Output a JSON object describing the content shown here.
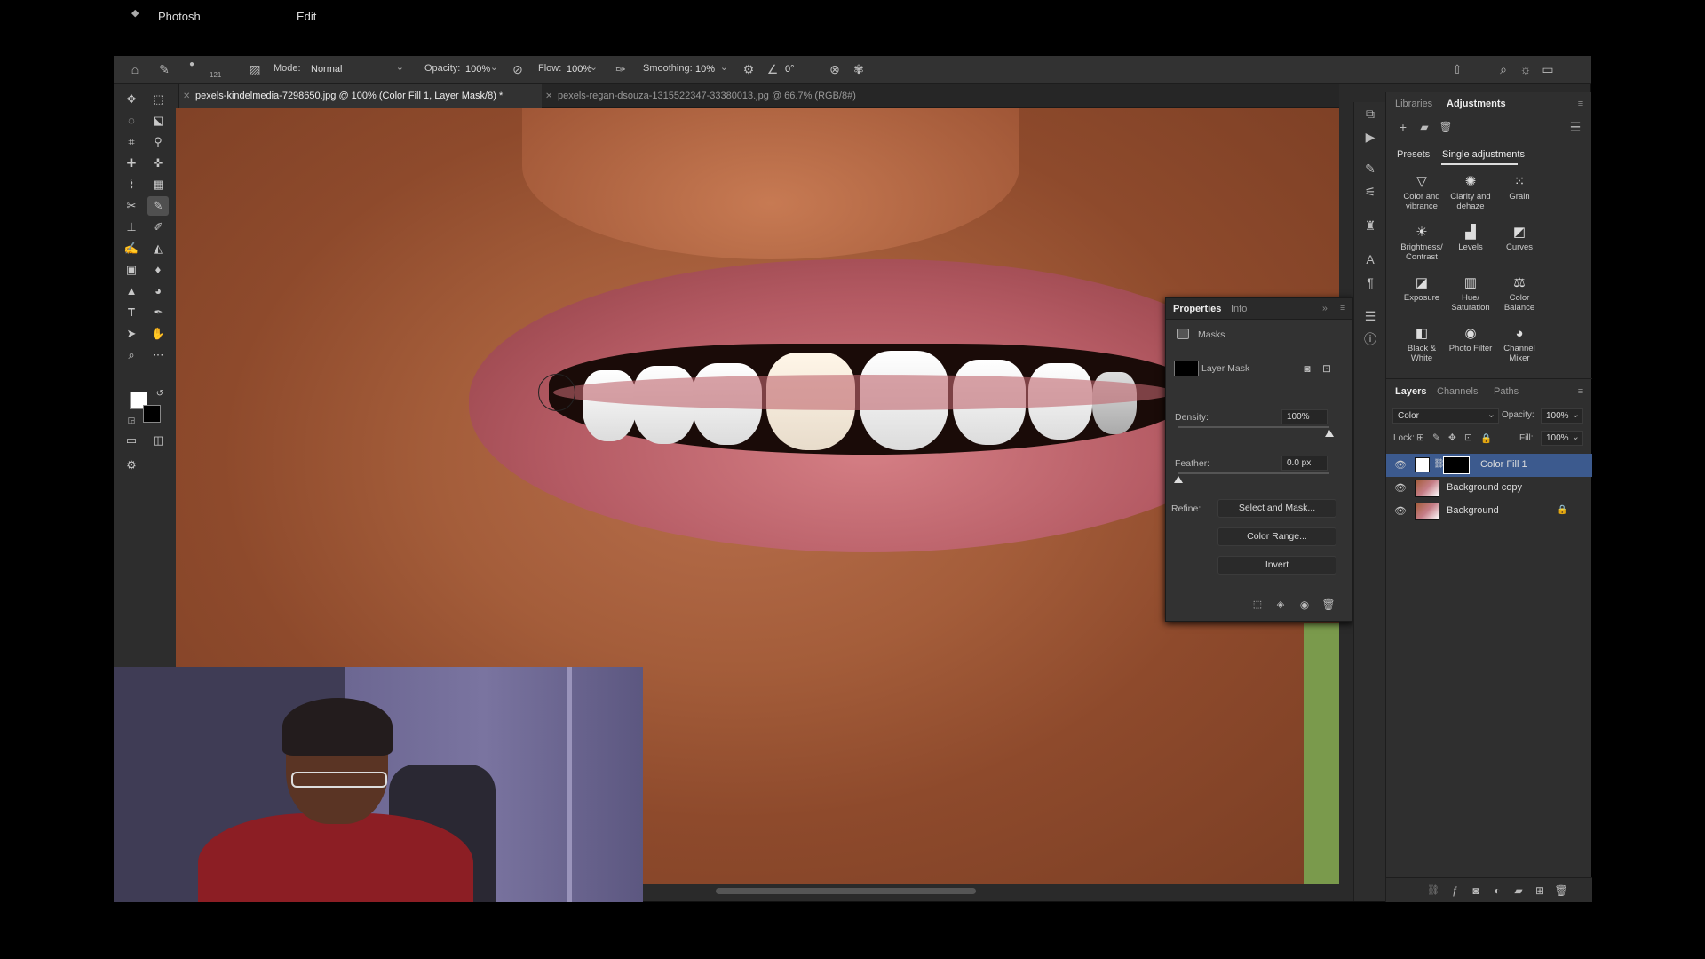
{
  "menubar": {
    "app_name": "Photosh",
    "edit_menu": "Edit"
  },
  "options": {
    "brush_size": "121",
    "mode_label": "Mode:",
    "mode_value": "Normal",
    "opacity_label": "Opacity:",
    "opacity_value": "100%",
    "flow_label": "Flow:",
    "flow_value": "100%",
    "smoothing_label": "Smoothing:",
    "smoothing_value": "10%",
    "angle_value": "0°"
  },
  "tabs": [
    {
      "label": "pexels-kindelmedia-7298650.jpg @ 100% (Color Fill 1, Layer Mask/8) *"
    },
    {
      "label": "pexels-regan-dsouza-1315522347-33380013.jpg @ 66.7% (RGB/8#)"
    }
  ],
  "properties": {
    "tabs": [
      "Properties",
      "Info"
    ],
    "section": "Masks",
    "mask_label": "Layer Mask",
    "density_label": "Density:",
    "density_value": "100%",
    "density_level": 1.0,
    "feather_label": "Feather:",
    "feather_value": "0.0 px",
    "feather_level": 0.0,
    "refine_label": "Refine:",
    "buttons": [
      "Select and Mask...",
      "Color Range...",
      "Invert"
    ]
  },
  "right_panel": {
    "top_tabs": [
      "Libraries",
      "Adjustments"
    ],
    "sub_tabs": [
      "Presets",
      "Single adjustments"
    ],
    "adjustments": [
      {
        "label": "Color and vibrance",
        "icon": "triangle-icon",
        "glyph": "▽"
      },
      {
        "label": "Clarity and dehaze",
        "icon": "sun-dots-icon",
        "glyph": "✺"
      },
      {
        "label": "Grain",
        "icon": "grain-icon",
        "glyph": "⁙"
      },
      {
        "label": "Brightness/ Contrast",
        "icon": "brightness-icon",
        "glyph": "☀"
      },
      {
        "label": "Levels",
        "icon": "levels-icon",
        "glyph": "▟"
      },
      {
        "label": "Curves",
        "icon": "curves-icon",
        "glyph": "◩"
      },
      {
        "label": "Exposure",
        "icon": "exposure-icon",
        "glyph": "◪"
      },
      {
        "label": "Hue/ Saturation",
        "icon": "hue-icon",
        "glyph": "▥"
      },
      {
        "label": "Color Balance",
        "icon": "balance-icon",
        "glyph": "⚖"
      },
      {
        "label": "Black & White",
        "icon": "bw-icon",
        "glyph": "◧"
      },
      {
        "label": "Photo Filter",
        "icon": "camera-icon",
        "glyph": "◉"
      },
      {
        "label": "Channel Mixer",
        "icon": "mixer-icon",
        "glyph": "◕"
      }
    ],
    "layer_tabs": [
      "Layers",
      "Channels",
      "Paths"
    ],
    "blend_value": "Color",
    "opacity_label": "Opacity:",
    "opacity_value": "100%",
    "lock_label": "Lock:",
    "fill_label": "Fill:",
    "fill_value": "100%",
    "layers": [
      {
        "name": "Color Fill 1",
        "selected": true
      },
      {
        "name": "Background copy",
        "selected": false
      },
      {
        "name": "Background",
        "selected": false,
        "locked": true
      }
    ]
  }
}
